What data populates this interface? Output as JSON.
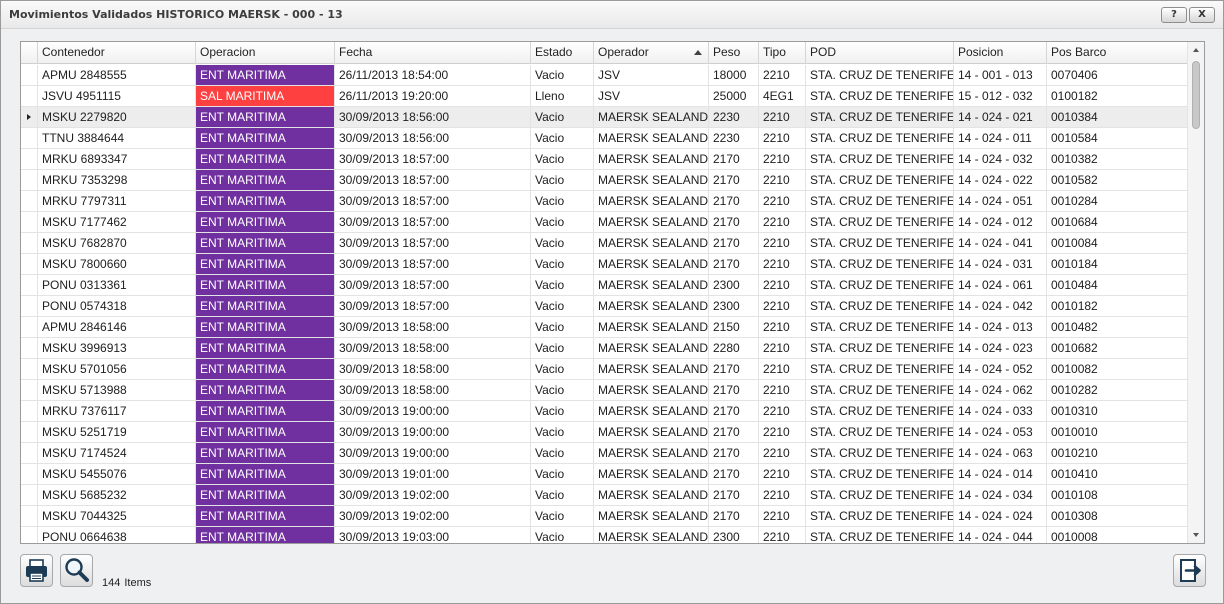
{
  "window": {
    "title": "Movimientos Validados HISTORICO MAERSK - 000 - 13",
    "help_label": "?",
    "close_label": "X"
  },
  "columns": [
    {
      "key": "contenedor",
      "label": "Contenedor"
    },
    {
      "key": "operacion",
      "label": "Operacion"
    },
    {
      "key": "fecha",
      "label": "Fecha"
    },
    {
      "key": "estado",
      "label": "Estado"
    },
    {
      "key": "operador",
      "label": "Operador",
      "sorted": "asc"
    },
    {
      "key": "peso",
      "label": "Peso"
    },
    {
      "key": "tipo",
      "label": "Tipo"
    },
    {
      "key": "pod",
      "label": "POD"
    },
    {
      "key": "posicion",
      "label": "Posicion"
    },
    {
      "key": "pos_barco",
      "label": "Pos Barco"
    }
  ],
  "colors": {
    "ent_maritima": "#7030a0",
    "sal_maritima": "#ff4040"
  },
  "rows": [
    [
      "APMU 2848555",
      "ENT MARITIMA",
      "26/11/2013 18:54:00",
      "Vacio",
      "JSV",
      "18000",
      "2210",
      "STA. CRUZ DE TENERIFE",
      "14 - 001 - 013",
      "0070406"
    ],
    [
      "JSVU 4951115",
      "SAL MARITIMA",
      "26/11/2013 19:20:00",
      "Lleno",
      "JSV",
      "25000",
      "4EG1",
      "STA. CRUZ DE TENERIFE",
      "15 - 012 - 032",
      "0100182"
    ],
    [
      "MSKU 2279820",
      "ENT MARITIMA",
      "30/09/2013 18:56:00",
      "Vacio",
      "MAERSK SEALAND",
      "2230",
      "2210",
      "STA. CRUZ DE TENERIFE",
      "14 - 024 - 021",
      "0010384"
    ],
    [
      "TTNU 3884644",
      "ENT MARITIMA",
      "30/09/2013 18:56:00",
      "Vacio",
      "MAERSK SEALAND",
      "2230",
      "2210",
      "STA. CRUZ DE TENERIFE",
      "14 - 024 - 011",
      "0010584"
    ],
    [
      "MRKU 6893347",
      "ENT MARITIMA",
      "30/09/2013 18:57:00",
      "Vacio",
      "MAERSK SEALAND",
      "2170",
      "2210",
      "STA. CRUZ DE TENERIFE",
      "14 - 024 - 032",
      "0010382"
    ],
    [
      "MRKU 7353298",
      "ENT MARITIMA",
      "30/09/2013 18:57:00",
      "Vacio",
      "MAERSK SEALAND",
      "2170",
      "2210",
      "STA. CRUZ DE TENERIFE",
      "14 - 024 - 022",
      "0010582"
    ],
    [
      "MRKU 7797311",
      "ENT MARITIMA",
      "30/09/2013 18:57:00",
      "Vacio",
      "MAERSK SEALAND",
      "2170",
      "2210",
      "STA. CRUZ DE TENERIFE",
      "14 - 024 - 051",
      "0010284"
    ],
    [
      "MSKU 7177462",
      "ENT MARITIMA",
      "30/09/2013 18:57:00",
      "Vacio",
      "MAERSK SEALAND",
      "2170",
      "2210",
      "STA. CRUZ DE TENERIFE",
      "14 - 024 - 012",
      "0010684"
    ],
    [
      "MSKU 7682870",
      "ENT MARITIMA",
      "30/09/2013 18:57:00",
      "Vacio",
      "MAERSK SEALAND",
      "2170",
      "2210",
      "STA. CRUZ DE TENERIFE",
      "14 - 024 - 041",
      "0010084"
    ],
    [
      "MSKU 7800660",
      "ENT MARITIMA",
      "30/09/2013 18:57:00",
      "Vacio",
      "MAERSK SEALAND",
      "2170",
      "2210",
      "STA. CRUZ DE TENERIFE",
      "14 - 024 - 031",
      "0010184"
    ],
    [
      "PONU 0313361",
      "ENT MARITIMA",
      "30/09/2013 18:57:00",
      "Vacio",
      "MAERSK SEALAND",
      "2300",
      "2210",
      "STA. CRUZ DE TENERIFE",
      "14 - 024 - 061",
      "0010484"
    ],
    [
      "PONU 0574318",
      "ENT MARITIMA",
      "30/09/2013 18:57:00",
      "Vacio",
      "MAERSK SEALAND",
      "2300",
      "2210",
      "STA. CRUZ DE TENERIFE",
      "14 - 024 - 042",
      "0010182"
    ],
    [
      "APMU 2846146",
      "ENT MARITIMA",
      "30/09/2013 18:58:00",
      "Vacio",
      "MAERSK SEALAND",
      "2150",
      "2210",
      "STA. CRUZ DE TENERIFE",
      "14 - 024 - 013",
      "0010482"
    ],
    [
      "MSKU 3996913",
      "ENT MARITIMA",
      "30/09/2013 18:58:00",
      "Vacio",
      "MAERSK SEALAND",
      "2280",
      "2210",
      "STA. CRUZ DE TENERIFE",
      "14 - 024 - 023",
      "0010682"
    ],
    [
      "MSKU 5701056",
      "ENT MARITIMA",
      "30/09/2013 18:58:00",
      "Vacio",
      "MAERSK SEALAND",
      "2170",
      "2210",
      "STA. CRUZ DE TENERIFE",
      "14 - 024 - 052",
      "0010082"
    ],
    [
      "MSKU 5713988",
      "ENT MARITIMA",
      "30/09/2013 18:58:00",
      "Vacio",
      "MAERSK SEALAND",
      "2170",
      "2210",
      "STA. CRUZ DE TENERIFE",
      "14 - 024 - 062",
      "0010282"
    ],
    [
      "MRKU 7376117",
      "ENT MARITIMA",
      "30/09/2013 19:00:00",
      "Vacio",
      "MAERSK SEALAND",
      "2170",
      "2210",
      "STA. CRUZ DE TENERIFE",
      "14 - 024 - 033",
      "0010310"
    ],
    [
      "MSKU 5251719",
      "ENT MARITIMA",
      "30/09/2013 19:00:00",
      "Vacio",
      "MAERSK SEALAND",
      "2170",
      "2210",
      "STA. CRUZ DE TENERIFE",
      "14 - 024 - 053",
      "0010010"
    ],
    [
      "MSKU 7174524",
      "ENT MARITIMA",
      "30/09/2013 19:00:00",
      "Vacio",
      "MAERSK SEALAND",
      "2170",
      "2210",
      "STA. CRUZ DE TENERIFE",
      "14 - 024 - 063",
      "0010210"
    ],
    [
      "MSKU 5455076",
      "ENT MARITIMA",
      "30/09/2013 19:01:00",
      "Vacio",
      "MAERSK SEALAND",
      "2170",
      "2210",
      "STA. CRUZ DE TENERIFE",
      "14 - 024 - 014",
      "0010410"
    ],
    [
      "MSKU 5685232",
      "ENT MARITIMA",
      "30/09/2013 19:02:00",
      "Vacio",
      "MAERSK SEALAND",
      "2170",
      "2210",
      "STA. CRUZ DE TENERIFE",
      "14 - 024 - 034",
      "0010108"
    ],
    [
      "MSKU 7044325",
      "ENT MARITIMA",
      "30/09/2013 19:02:00",
      "Vacio",
      "MAERSK SEALAND",
      "2170",
      "2210",
      "STA. CRUZ DE TENERIFE",
      "14 - 024 - 024",
      "0010308"
    ],
    [
      "PONU 0664638",
      "ENT MARITIMA",
      "30/09/2013 19:03:00",
      "Vacio",
      "MAERSK SEALAND",
      "2300",
      "2210",
      "STA. CRUZ DE TENERIFE",
      "14 - 024 - 044",
      "0010008"
    ]
  ],
  "selected_row": 2,
  "footer": {
    "count": "144",
    "count_label": "Items",
    "print_icon": "printer-icon",
    "search_icon": "magnifier-icon",
    "exit_icon": "exit-icon"
  }
}
